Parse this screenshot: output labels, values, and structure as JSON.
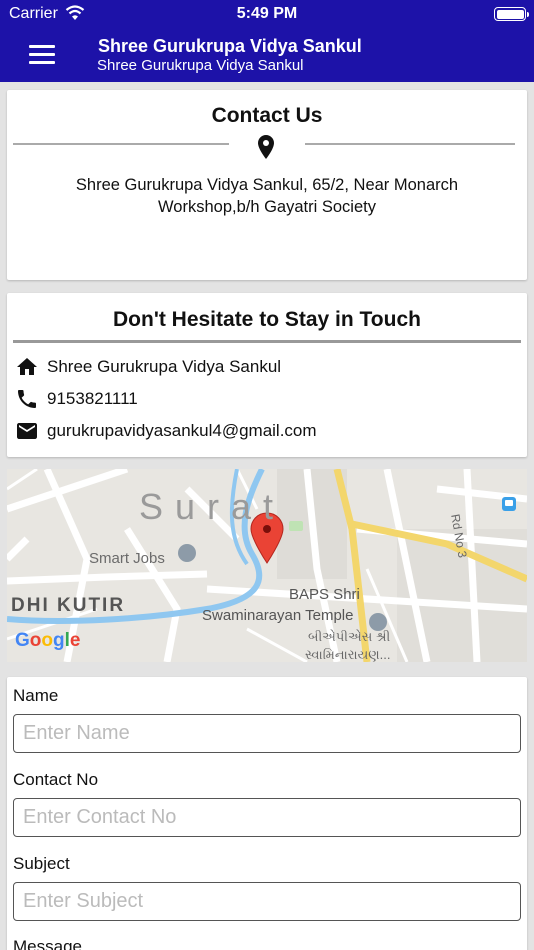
{
  "status_bar": {
    "carrier": "Carrier",
    "time": "5:49 PM",
    "battery_level": 1.0
  },
  "app_bar": {
    "title": "Shree Gurukrupa Vidya Sankul",
    "subtitle": "Shree Gurukrupa Vidya Sankul",
    "menu_icon": "hamburger-menu-icon"
  },
  "contact_card": {
    "heading": "Contact Us",
    "icon": "location-pin-icon",
    "address": "Shree Gurukrupa Vidya Sankul, 65/2, Near Monarch Workshop,b/h Gayatri Society"
  },
  "touch_card": {
    "heading": "Don't Hesitate to Stay in Touch",
    "items": [
      {
        "icon": "home-icon",
        "text": "Shree Gurukrupa Vidya Sankul"
      },
      {
        "icon": "phone-icon",
        "text": "9153821111"
      },
      {
        "icon": "email-icon",
        "text": "gurukrupavidyasankul4@gmail.com"
      }
    ]
  },
  "map": {
    "labels": {
      "city": "Surat",
      "place": "Smart Jobs",
      "area": "DHI KUTIR",
      "temple_line1": "BAPS Shri",
      "temple_line2": "Swaminarayan Temple",
      "temple_gujarati_line1": "બીએપીએસ શ્રી",
      "temple_gujarati_line2": "સ્વામિનારાયણ...",
      "road": "Rd No 3"
    },
    "attribution": "Google",
    "marker_icon": "map-marker-icon"
  },
  "form": {
    "fields": [
      {
        "label": "Name",
        "placeholder": "Enter Name",
        "value": ""
      },
      {
        "label": "Contact No",
        "placeholder": "Enter Contact No",
        "value": ""
      },
      {
        "label": "Subject",
        "placeholder": "Enter Subject",
        "value": ""
      },
      {
        "label": "Message"
      }
    ]
  },
  "colors": {
    "primary": "#1d12a8",
    "background": "#e3e3e3",
    "card": "#ffffff"
  }
}
